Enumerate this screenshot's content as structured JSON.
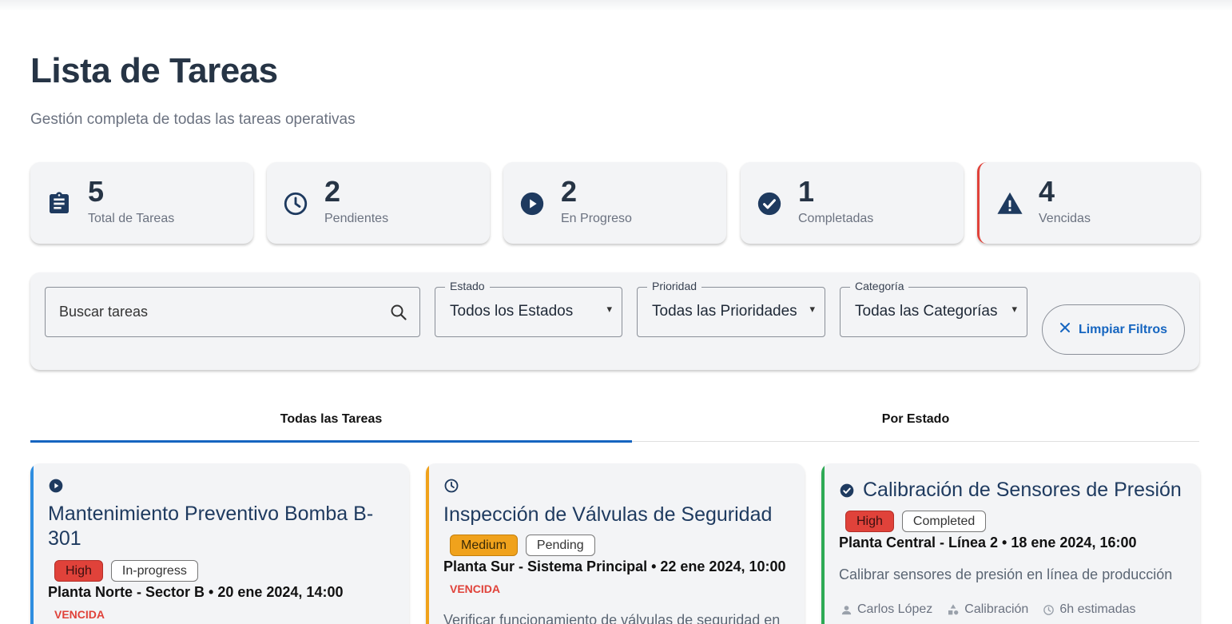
{
  "header": {
    "title": "Lista de Tareas",
    "subtitle": "Gestión completa de todas las tareas operativas"
  },
  "stats": [
    {
      "value": "5",
      "label": "Total de Tareas",
      "icon": "clipboard-icon"
    },
    {
      "value": "2",
      "label": "Pendientes",
      "icon": "clock-icon"
    },
    {
      "value": "2",
      "label": "En Progreso",
      "icon": "play-circle-icon"
    },
    {
      "value": "1",
      "label": "Completadas",
      "icon": "check-circle-icon"
    },
    {
      "value": "4",
      "label": "Vencidas",
      "icon": "warning-icon",
      "accent": "#e0423a"
    }
  ],
  "filters": {
    "search_placeholder": "Buscar tareas",
    "estado": {
      "label": "Estado",
      "value": "Todos los Estados"
    },
    "prioridad": {
      "label": "Prioridad",
      "value": "Todas las Prioridades"
    },
    "categoria": {
      "label": "Categoría",
      "value": "Todas las Categorías"
    },
    "clear_label": "Limpiar Filtros"
  },
  "tabs": [
    {
      "label": "Todas las Tareas",
      "active": true
    },
    {
      "label": "Por Estado",
      "active": false
    }
  ],
  "tasks": [
    {
      "title_line1": "Mantenimiento Preventivo Bomba B-",
      "title_line2": "301",
      "priority": "High",
      "status": "In-progress",
      "location": "Planta Norte - Sector B • 20 ene 2024, 14:00",
      "overdue": "VENCIDA",
      "accent": "#2f8ee0",
      "icon": "play-circle-icon"
    },
    {
      "title": "Inspección de Válvulas de Seguridad",
      "priority": "Medium",
      "status": "Pending",
      "location": "Planta Sur - Sistema Principal • 22 ene 2024, 10:00",
      "overdue": "VENCIDA",
      "description": "Verificar funcionamiento de válvulas de seguridad en",
      "accent": "#f0a21c",
      "icon": "clock-icon"
    },
    {
      "title": "Calibración de Sensores de Presión",
      "priority": "High",
      "status": "Completed",
      "location": "Planta Central - Línea 2 • 18 ene 2024, 16:00",
      "description": "Calibrar sensores de presión en línea de producción",
      "assignee": "Carlos López",
      "category": "Calibración",
      "estimate": "6h estimadas",
      "accent": "#2eaa55",
      "icon": "check-circle-icon"
    }
  ],
  "colors": {
    "primary": "#1565c0",
    "dark": "#263445",
    "danger": "#e0423a",
    "warning": "#f0a21c",
    "success": "#2eaa55",
    "info": "#2f8ee0"
  }
}
